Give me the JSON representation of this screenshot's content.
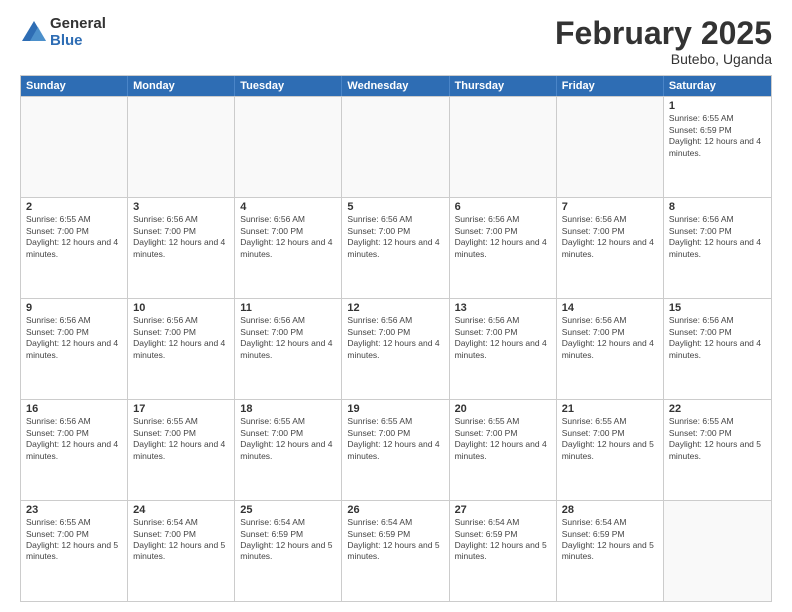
{
  "logo": {
    "general": "General",
    "blue": "Blue"
  },
  "header": {
    "title": "February 2025",
    "location": "Butebo, Uganda"
  },
  "weekdays": [
    "Sunday",
    "Monday",
    "Tuesday",
    "Wednesday",
    "Thursday",
    "Friday",
    "Saturday"
  ],
  "weeks": [
    [
      {
        "day": "",
        "empty": true
      },
      {
        "day": "",
        "empty": true
      },
      {
        "day": "",
        "empty": true
      },
      {
        "day": "",
        "empty": true
      },
      {
        "day": "",
        "empty": true
      },
      {
        "day": "",
        "empty": true
      },
      {
        "day": "1",
        "sunrise": "Sunrise: 6:55 AM",
        "sunset": "Sunset: 6:59 PM",
        "daylight": "Daylight: 12 hours and 4 minutes."
      }
    ],
    [
      {
        "day": "2",
        "sunrise": "Sunrise: 6:55 AM",
        "sunset": "Sunset: 7:00 PM",
        "daylight": "Daylight: 12 hours and 4 minutes."
      },
      {
        "day": "3",
        "sunrise": "Sunrise: 6:56 AM",
        "sunset": "Sunset: 7:00 PM",
        "daylight": "Daylight: 12 hours and 4 minutes."
      },
      {
        "day": "4",
        "sunrise": "Sunrise: 6:56 AM",
        "sunset": "Sunset: 7:00 PM",
        "daylight": "Daylight: 12 hours and 4 minutes."
      },
      {
        "day": "5",
        "sunrise": "Sunrise: 6:56 AM",
        "sunset": "Sunset: 7:00 PM",
        "daylight": "Daylight: 12 hours and 4 minutes."
      },
      {
        "day": "6",
        "sunrise": "Sunrise: 6:56 AM",
        "sunset": "Sunset: 7:00 PM",
        "daylight": "Daylight: 12 hours and 4 minutes."
      },
      {
        "day": "7",
        "sunrise": "Sunrise: 6:56 AM",
        "sunset": "Sunset: 7:00 PM",
        "daylight": "Daylight: 12 hours and 4 minutes."
      },
      {
        "day": "8",
        "sunrise": "Sunrise: 6:56 AM",
        "sunset": "Sunset: 7:00 PM",
        "daylight": "Daylight: 12 hours and 4 minutes."
      }
    ],
    [
      {
        "day": "9",
        "sunrise": "Sunrise: 6:56 AM",
        "sunset": "Sunset: 7:00 PM",
        "daylight": "Daylight: 12 hours and 4 minutes."
      },
      {
        "day": "10",
        "sunrise": "Sunrise: 6:56 AM",
        "sunset": "Sunset: 7:00 PM",
        "daylight": "Daylight: 12 hours and 4 minutes."
      },
      {
        "day": "11",
        "sunrise": "Sunrise: 6:56 AM",
        "sunset": "Sunset: 7:00 PM",
        "daylight": "Daylight: 12 hours and 4 minutes."
      },
      {
        "day": "12",
        "sunrise": "Sunrise: 6:56 AM",
        "sunset": "Sunset: 7:00 PM",
        "daylight": "Daylight: 12 hours and 4 minutes."
      },
      {
        "day": "13",
        "sunrise": "Sunrise: 6:56 AM",
        "sunset": "Sunset: 7:00 PM",
        "daylight": "Daylight: 12 hours and 4 minutes."
      },
      {
        "day": "14",
        "sunrise": "Sunrise: 6:56 AM",
        "sunset": "Sunset: 7:00 PM",
        "daylight": "Daylight: 12 hours and 4 minutes."
      },
      {
        "day": "15",
        "sunrise": "Sunrise: 6:56 AM",
        "sunset": "Sunset: 7:00 PM",
        "daylight": "Daylight: 12 hours and 4 minutes."
      }
    ],
    [
      {
        "day": "16",
        "sunrise": "Sunrise: 6:56 AM",
        "sunset": "Sunset: 7:00 PM",
        "daylight": "Daylight: 12 hours and 4 minutes."
      },
      {
        "day": "17",
        "sunrise": "Sunrise: 6:55 AM",
        "sunset": "Sunset: 7:00 PM",
        "daylight": "Daylight: 12 hours and 4 minutes."
      },
      {
        "day": "18",
        "sunrise": "Sunrise: 6:55 AM",
        "sunset": "Sunset: 7:00 PM",
        "daylight": "Daylight: 12 hours and 4 minutes."
      },
      {
        "day": "19",
        "sunrise": "Sunrise: 6:55 AM",
        "sunset": "Sunset: 7:00 PM",
        "daylight": "Daylight: 12 hours and 4 minutes."
      },
      {
        "day": "20",
        "sunrise": "Sunrise: 6:55 AM",
        "sunset": "Sunset: 7:00 PM",
        "daylight": "Daylight: 12 hours and 4 minutes."
      },
      {
        "day": "21",
        "sunrise": "Sunrise: 6:55 AM",
        "sunset": "Sunset: 7:00 PM",
        "daylight": "Daylight: 12 hours and 5 minutes."
      },
      {
        "day": "22",
        "sunrise": "Sunrise: 6:55 AM",
        "sunset": "Sunset: 7:00 PM",
        "daylight": "Daylight: 12 hours and 5 minutes."
      }
    ],
    [
      {
        "day": "23",
        "sunrise": "Sunrise: 6:55 AM",
        "sunset": "Sunset: 7:00 PM",
        "daylight": "Daylight: 12 hours and 5 minutes."
      },
      {
        "day": "24",
        "sunrise": "Sunrise: 6:54 AM",
        "sunset": "Sunset: 7:00 PM",
        "daylight": "Daylight: 12 hours and 5 minutes."
      },
      {
        "day": "25",
        "sunrise": "Sunrise: 6:54 AM",
        "sunset": "Sunset: 6:59 PM",
        "daylight": "Daylight: 12 hours and 5 minutes."
      },
      {
        "day": "26",
        "sunrise": "Sunrise: 6:54 AM",
        "sunset": "Sunset: 6:59 PM",
        "daylight": "Daylight: 12 hours and 5 minutes."
      },
      {
        "day": "27",
        "sunrise": "Sunrise: 6:54 AM",
        "sunset": "Sunset: 6:59 PM",
        "daylight": "Daylight: 12 hours and 5 minutes."
      },
      {
        "day": "28",
        "sunrise": "Sunrise: 6:54 AM",
        "sunset": "Sunset: 6:59 PM",
        "daylight": "Daylight: 12 hours and 5 minutes."
      },
      {
        "day": "",
        "empty": true
      }
    ]
  ]
}
